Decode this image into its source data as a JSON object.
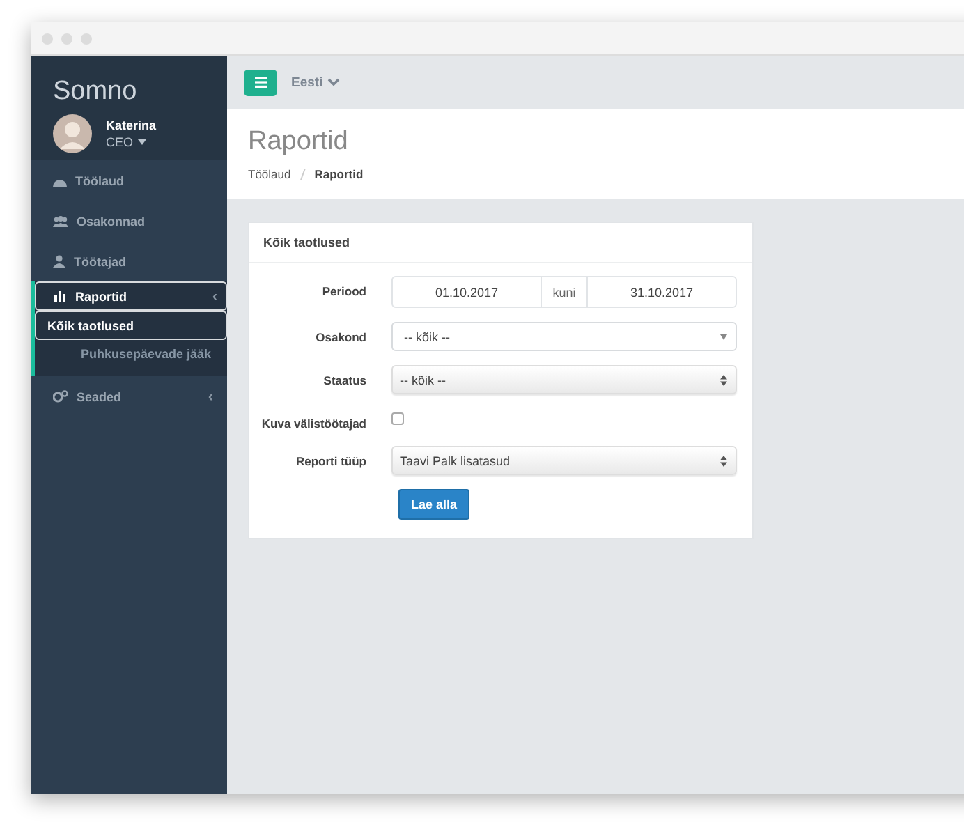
{
  "sidebar": {
    "logo": "Somno",
    "user": {
      "name": "Katerina",
      "role": "CEO"
    },
    "items": [
      {
        "label": "Töölaud",
        "selected": false,
        "expanded": false
      },
      {
        "label": "Osakonnad",
        "selected": false,
        "expanded": false
      },
      {
        "label": "Töötajad",
        "selected": false,
        "expanded": false
      },
      {
        "label": "Raportid",
        "selected": true,
        "expanded": true,
        "caret": "‹",
        "children": [
          {
            "label": "Kõik taotlused",
            "selected": true
          },
          {
            "label": "Puhkusepäevade jääk",
            "selected": false
          }
        ]
      },
      {
        "label": "Seaded",
        "selected": false,
        "expanded": false,
        "caret": "‹"
      }
    ]
  },
  "topbar": {
    "language": "Eesti"
  },
  "header": {
    "title": "Raportid",
    "breadcrumb": [
      {
        "label": "Töölaud",
        "current": false
      },
      {
        "label": "Raportid",
        "current": true
      }
    ]
  },
  "card": {
    "title": "Kõik taotlused",
    "rows": [
      {
        "kind": "daterange",
        "label": "Periood",
        "from": "01.10.2017",
        "separator": "kuni",
        "to": "31.10.2017"
      },
      {
        "kind": "select",
        "label": "Osakond",
        "value": "-- kõik --"
      },
      {
        "kind": "native",
        "label": "Staatus",
        "value": "-- kõik --"
      },
      {
        "kind": "checkbox",
        "label": "Kuva välistöötajad",
        "checked": false
      },
      {
        "kind": "native",
        "label": "Reporti tüüp",
        "value": "Taavi Palk lisatasud"
      }
    ],
    "button": "Lae alla"
  }
}
